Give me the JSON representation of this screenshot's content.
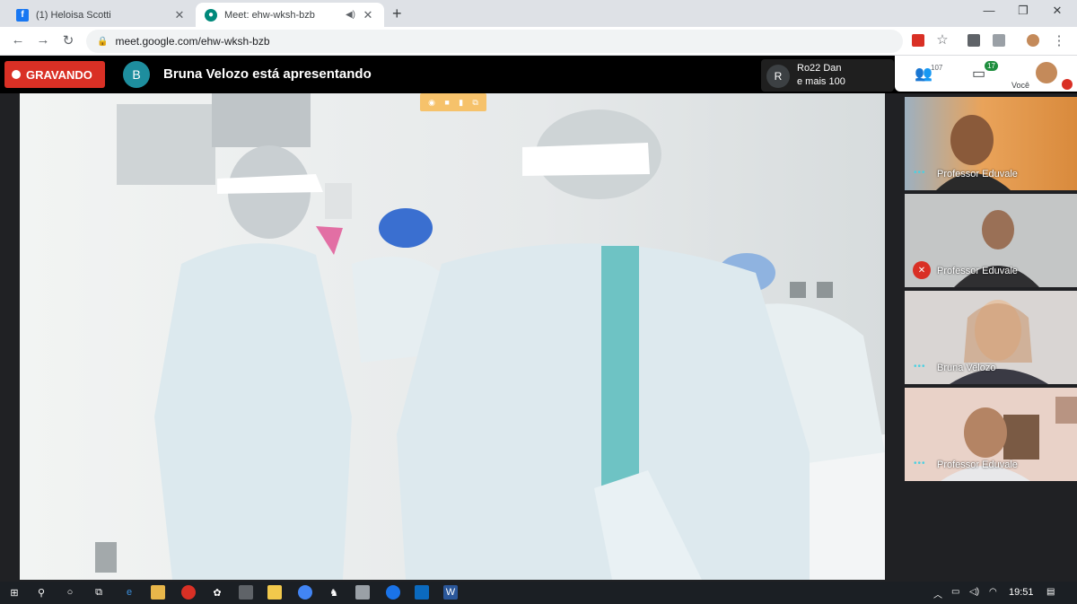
{
  "browser": {
    "tabs": [
      {
        "title": "(1) Heloisa Scotti",
        "favicon": "facebook-icon",
        "active": false
      },
      {
        "title": "Meet: ehw-wksh-bzb",
        "favicon": "meet-icon",
        "active": true
      }
    ],
    "url": "meet.google.com/ehw-wksh-bzb"
  },
  "meet": {
    "recording_label": "GRAVANDO",
    "presenter_initial": "B",
    "presenting_text": "Bruna Velozo está apresentando",
    "pinned": {
      "initial": "R",
      "line1": "Ro22 Dan",
      "line2": "e mais 100"
    },
    "participants_count": "107",
    "chat_badge": "17",
    "you_label": "Você"
  },
  "tiles": [
    {
      "name": "Professor Eduvale",
      "state": "speaking-dots"
    },
    {
      "name": "Professor Eduvale",
      "state": "muted"
    },
    {
      "name": "Bruna Velozo",
      "state": "speaking-dots"
    },
    {
      "name": "Professor Eduvale",
      "state": "speaking-dots"
    }
  ],
  "taskbar": {
    "clock": "19:51"
  },
  "colors": {
    "recording": "#d93025",
    "presenter_avatar": "#1e8e9e",
    "chat_badge": "#1e8e3e",
    "speaking_dots": "#4dd0e1"
  }
}
